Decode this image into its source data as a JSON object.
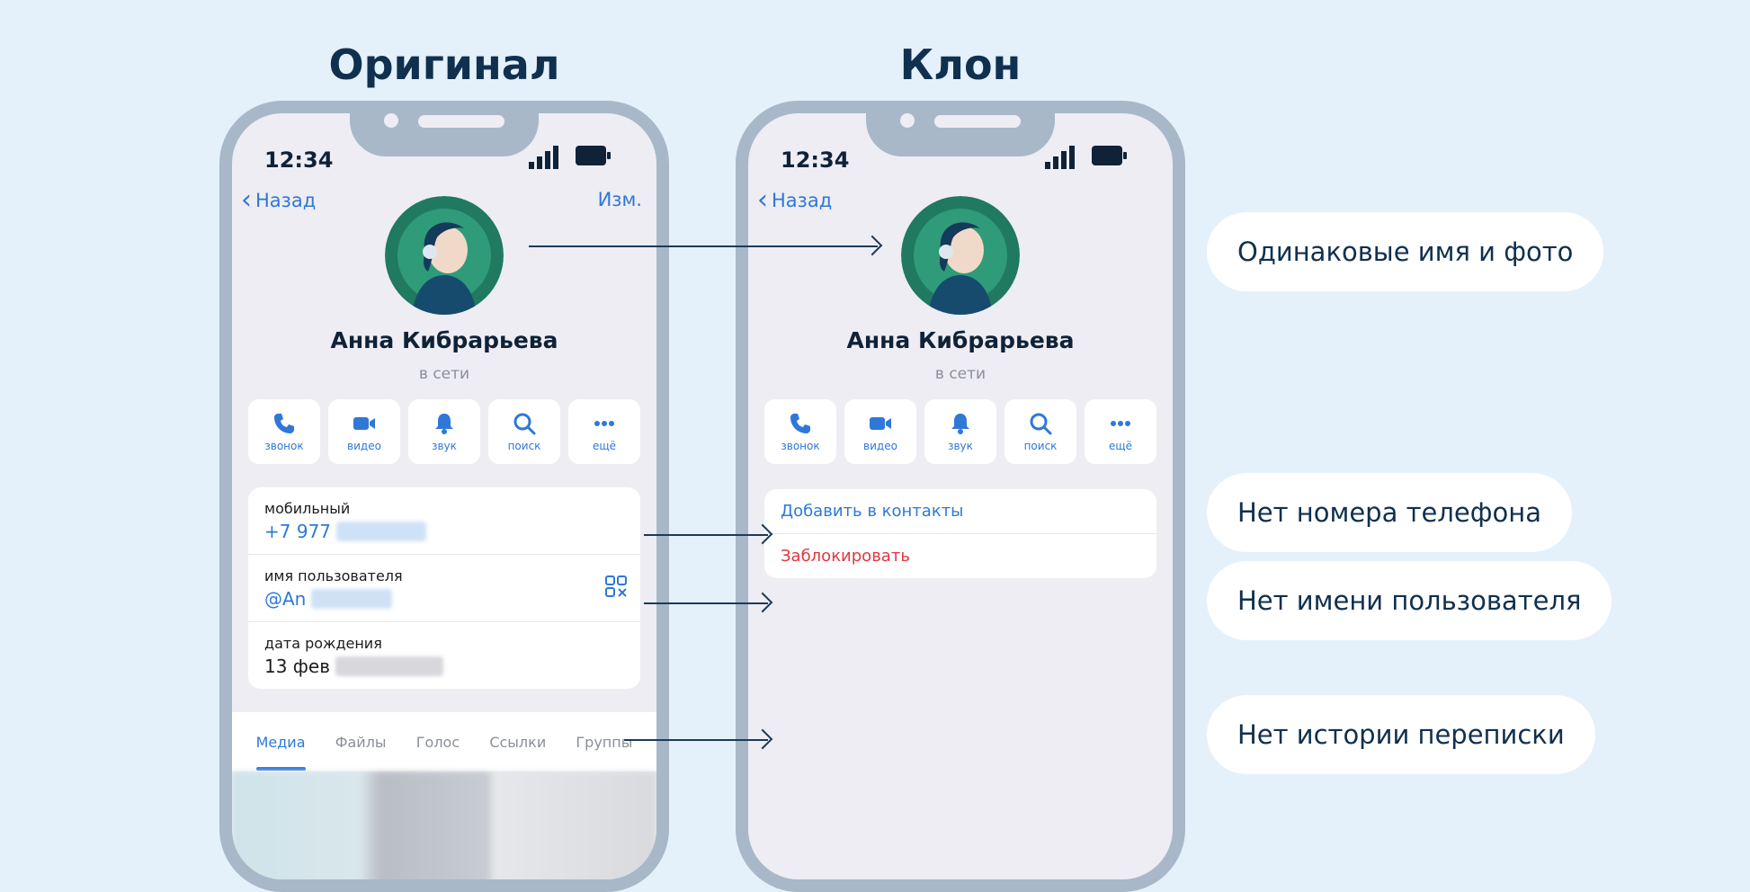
{
  "titles": {
    "original": "Оригинал",
    "clone": "Клон"
  },
  "status": {
    "time": "12:34"
  },
  "nav": {
    "back": "Назад",
    "edit": "Изм."
  },
  "profile": {
    "name": "Анна Кибрарьева",
    "status": "в сети"
  },
  "actions": [
    {
      "label": "звонок",
      "icon": "phone-icon"
    },
    {
      "label": "видео",
      "icon": "video-icon"
    },
    {
      "label": "звук",
      "icon": "bell-icon"
    },
    {
      "label": "поиск",
      "icon": "search-icon"
    },
    {
      "label": "ещё",
      "icon": "more-icon"
    }
  ],
  "info": {
    "mobile_label": "мобильный",
    "mobile_value": "+7 977",
    "username_label": "имя пользователя",
    "username_value": "@An",
    "birthday_label": "дата рождения",
    "birthday_value": "13 фев"
  },
  "tabs": [
    "Медиа",
    "Файлы",
    "Голос",
    "Ссылки",
    "Группы"
  ],
  "clone_menu": {
    "add": "Добавить в контакты",
    "block": "Заблокировать"
  },
  "labels": {
    "same": "Одинаковые имя и фото",
    "no_phone": "Нет номера телефона",
    "no_username": "Нет имени пользователя",
    "no_history": "Нет истории переписки"
  },
  "colors": {
    "accent": "#2f78d8",
    "danger": "#e0383e",
    "frame": "#a8b8c8",
    "background": "#e4f1fb"
  }
}
